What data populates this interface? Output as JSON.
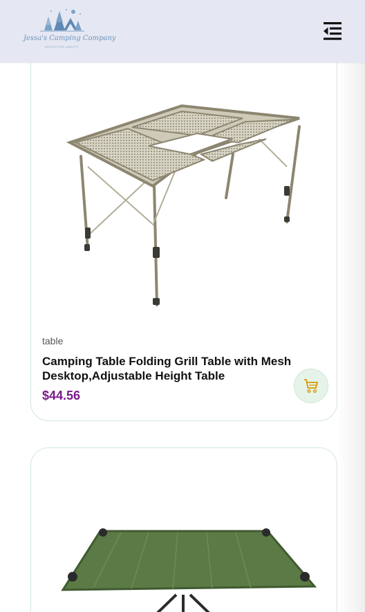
{
  "header": {
    "logo_text": "Jessa's Camping Company",
    "logo_subtext": "ADVENTURE AWAITS",
    "menu_icon": "menu-collapse-icon",
    "colors": {
      "background": "#e5e8f3",
      "logo": "#6f93b8"
    }
  },
  "products": [
    {
      "category": "table",
      "title": "Camping Table Folding Grill Table with Mesh Desktop,Adjustable Height Table",
      "price": "$44.56",
      "cart_icon": "cart-icon",
      "image": "folding-grill-table-image"
    },
    {
      "image": "green-folding-table-image"
    }
  ],
  "colors": {
    "price": "#7a1a8a",
    "cart_icon": "#d9a21b",
    "cart_bg": "#e6f3e8",
    "card_border": "#d2e6dc"
  }
}
